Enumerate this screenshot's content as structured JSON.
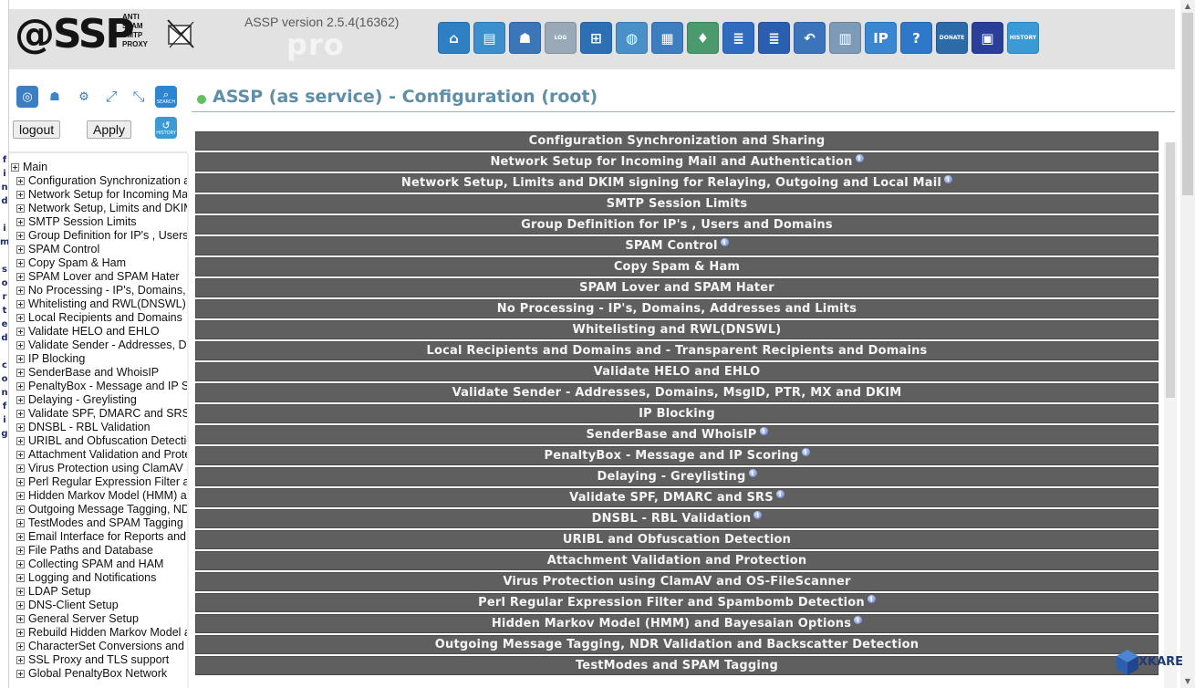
{
  "app": {
    "logo_text": "@SSP",
    "logo_tagline": [
      "ANTI",
      "SPAM",
      "SMTP",
      "PROXY"
    ],
    "version": "ASSP version 2.5.4(16362)",
    "edition": "pro"
  },
  "toolbar": [
    {
      "icon": "home-icon",
      "label": "",
      "color": "#2f7fc4",
      "glyph": "⌂"
    },
    {
      "icon": "document-icon",
      "label": "",
      "color": "#3b8fcc",
      "glyph": "▤"
    },
    {
      "icon": "user-edit-icon",
      "label": "",
      "color": "#3a76b8",
      "glyph": "☗"
    },
    {
      "icon": "log-icon",
      "label": "LOG",
      "color": "#9aa9b8",
      "glyph": ""
    },
    {
      "icon": "report-icon",
      "label": "",
      "color": "#2c6fb4",
      "glyph": "⊞"
    },
    {
      "icon": "globe-icon",
      "label": "",
      "color": "#4a90c8",
      "glyph": "◍"
    },
    {
      "icon": "calendar-icon",
      "label": "",
      "color": "#3d7ec0",
      "glyph": "▦"
    },
    {
      "icon": "monitor-icon",
      "label": "",
      "color": "#4a9a6e",
      "glyph": "♦"
    },
    {
      "icon": "notebook-icon",
      "label": "",
      "color": "#2f6cc0",
      "glyph": "≣"
    },
    {
      "icon": "notebook-alt-icon",
      "label": "",
      "color": "#2a5fb0",
      "glyph": "≣"
    },
    {
      "icon": "undo-icon",
      "label": "",
      "color": "#3c74bc",
      "glyph": "↶"
    },
    {
      "icon": "book-icon",
      "label": "",
      "color": "#7d9bb8",
      "glyph": "▥"
    },
    {
      "icon": "ip-icon",
      "label": "",
      "color": "#3b86d0",
      "glyph": "IP"
    },
    {
      "icon": "help-icon",
      "label": "",
      "color": "#2d78c8",
      "glyph": "?"
    },
    {
      "icon": "donate-icon",
      "label": "DONATE",
      "color": "#2c6aa8",
      "glyph": ""
    },
    {
      "icon": "save-icon",
      "label": "",
      "color": "#2a3f9a",
      "glyph": "▣"
    },
    {
      "icon": "history-icon",
      "label": "HISTORY",
      "color": "#3a9ad6",
      "glyph": ""
    }
  ],
  "left_panel": {
    "logout_label": "logout",
    "apply_label": "Apply",
    "search_label": "SEARCH",
    "history_label": "HISTORY",
    "tree_root": "Main",
    "tree_items": [
      "Configuration Synchronization a",
      "Network Setup for Incoming Mai",
      "Network Setup, Limits and DKIM",
      "SMTP Session Limits",
      "Group Definition for IP's , Users",
      "SPAM Control",
      "Copy Spam & Ham",
      "SPAM Lover and SPAM Hater",
      "No Processing - IP's, Domains,",
      "Whitelisting and RWL(DNSWL)",
      "Local Recipients and Domains",
      "Validate HELO and EHLO",
      "Validate Sender - Addresses, D",
      "IP Blocking",
      "SenderBase and WhoisIP",
      "PenaltyBox - Message and IP Sc",
      "Delaying - Greylisting",
      "Validate SPF, DMARC and SRS",
      "DNSBL - RBL Validation",
      "URIBL and Obfuscation Detectio",
      "Attachment Validation and Prote",
      "Virus Protection using ClamAV a",
      "Perl Regular Expression Filter a",
      "Hidden Markov Model (HMM) an",
      "Outgoing Message Tagging, ND",
      "TestModes and SPAM Tagging",
      "Email Interface for Reports and",
      "File Paths and Database",
      "Collecting SPAM and HAM",
      "Logging and Notifications",
      "LDAP Setup",
      "DNS-Client Setup",
      "General Server Setup",
      "Rebuild Hidden Markov Model a",
      "CharacterSet Conversions and",
      "SSL Proxy and TLS support",
      "Global PenaltyBox Network"
    ]
  },
  "edge_strip_chars": [
    "f",
    "i",
    "n",
    "d",
    "i",
    "m",
    "s",
    "o",
    "r",
    "t",
    "e",
    "d",
    "c",
    "o",
    "n",
    "f",
    "i",
    "g"
  ],
  "main": {
    "title": "ASSP (as service) - Configuration (root)",
    "sections": [
      {
        "label": "Configuration Synchronization and Sharing",
        "info": false
      },
      {
        "label": "Network Setup for Incoming Mail and Authentication",
        "info": true
      },
      {
        "label": "Network Setup, Limits and DKIM signing for Relaying, Outgoing and Local Mail",
        "info": true
      },
      {
        "label": "SMTP Session Limits",
        "info": false
      },
      {
        "label": "Group Definition for IP's , Users and Domains",
        "info": false
      },
      {
        "label": "SPAM Control",
        "info": true
      },
      {
        "label": "Copy Spam & Ham",
        "info": false
      },
      {
        "label": "SPAM Lover and SPAM Hater",
        "info": false
      },
      {
        "label": "No Processing - IP's, Domains, Addresses and Limits",
        "info": false
      },
      {
        "label": "Whitelisting and RWL(DNSWL)",
        "info": false
      },
      {
        "label": "Local Recipients and Domains and - Transparent Recipients and Domains",
        "info": false
      },
      {
        "label": "Validate HELO and EHLO",
        "info": false
      },
      {
        "label": "Validate Sender - Addresses, Domains, MsgID, PTR, MX and DKIM",
        "info": false
      },
      {
        "label": "IP Blocking",
        "info": false
      },
      {
        "label": "SenderBase and WhoisIP",
        "info": true
      },
      {
        "label": "PenaltyBox - Message and IP Scoring",
        "info": true
      },
      {
        "label": "Delaying - Greylisting",
        "info": true
      },
      {
        "label": "Validate SPF, DMARC and SRS",
        "info": true
      },
      {
        "label": "DNSBL - RBL Validation",
        "info": true
      },
      {
        "label": "URIBL and Obfuscation Detection",
        "info": false
      },
      {
        "label": "Attachment Validation and Protection",
        "info": false
      },
      {
        "label": "Virus Protection using ClamAV and OS-FileScanner",
        "info": false
      },
      {
        "label": "Perl Regular Expression Filter and Spambomb Detection",
        "info": true
      },
      {
        "label": "Hidden Markov Model (HMM) and Bayesaian Options",
        "info": true
      },
      {
        "label": "Outgoing Message Tagging, NDR Validation and Backscatter Detection",
        "info": false
      },
      {
        "label": "TestModes and SPAM Tagging",
        "info": false
      }
    ]
  },
  "watermark": "XKARE"
}
